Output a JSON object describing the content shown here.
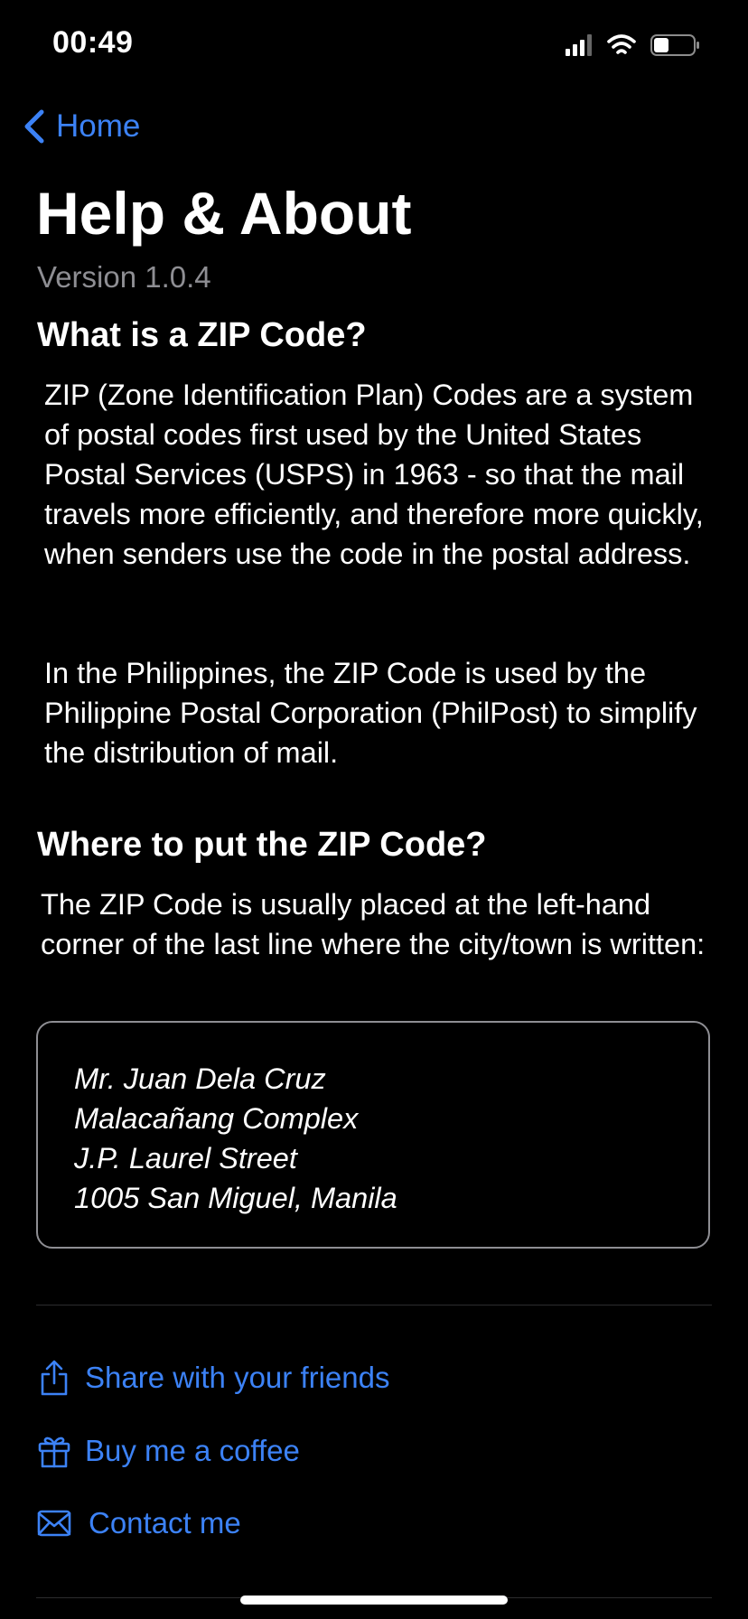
{
  "status": {
    "time": "00:49",
    "icons": [
      "cellular-signal-icon",
      "wifi-icon",
      "battery-icon"
    ]
  },
  "nav": {
    "back_label": "Home"
  },
  "page": {
    "title": "Help & About",
    "version": "Version 1.0.4"
  },
  "sections": {
    "what": {
      "heading": "What is a ZIP Code?",
      "paragraph1": "ZIP (Zone Identification Plan) Codes are a system of postal codes first used by the United States Postal Services (USPS) in 1963 - so that the mail travels more efficiently, and therefore more quickly, when senders use the code in the postal address.",
      "paragraph2": "In the Philippines, the ZIP Code is used by the Philippine Postal Corporation (PhilPost) to simplify the distribution of mail."
    },
    "where": {
      "heading": "Where to put the ZIP Code?",
      "paragraph": "The ZIP Code is usually placed at the left-hand corner of the last line where the city/town is written:",
      "address": {
        "line1": "Mr. Juan Dela Cruz",
        "line2": "Malacañang Complex",
        "line3": "J.P. Laurel Street",
        "line4": "1005 San Miguel, Manila"
      }
    }
  },
  "actions": {
    "share": {
      "label": "Share with your friends",
      "icon": "share-icon"
    },
    "coffee": {
      "label": "Buy me a coffee",
      "icon": "gift-icon"
    },
    "contact": {
      "label": "Contact me",
      "icon": "envelope-icon"
    }
  },
  "colors": {
    "background": "#000000",
    "text": "#ffffff",
    "secondary_text": "#8e8e93",
    "accent": "#3c82f6"
  }
}
